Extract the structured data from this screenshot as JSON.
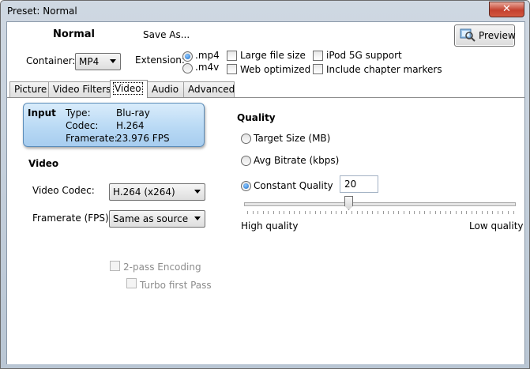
{
  "window": {
    "title": "Preset: Normal",
    "close_glyph": "✕"
  },
  "header": {
    "preset_name": "Normal",
    "save_as_label": "Save As...",
    "preview_label": "Preview",
    "container_label": "Container:",
    "container_value": "MP4",
    "extension_label": "Extension:",
    "extensions": [
      {
        "label": ".mp4",
        "selected": true
      },
      {
        "label": ".m4v",
        "selected": false
      }
    ],
    "options": [
      {
        "label": "Large file size",
        "checked": false
      },
      {
        "label": "Web optimized",
        "checked": false
      },
      {
        "label": "iPod 5G support",
        "checked": false
      },
      {
        "label": "Include chapter markers",
        "checked": false
      }
    ]
  },
  "tabs": [
    {
      "label": "Picture",
      "active": false
    },
    {
      "label": "Video Filters",
      "active": false
    },
    {
      "label": "Video",
      "active": true
    },
    {
      "label": "Audio",
      "active": false
    },
    {
      "label": "Advanced",
      "active": false
    }
  ],
  "input_info": {
    "heading": "Input",
    "type_label": "Type:",
    "type_value": "Blu-ray",
    "codec_label": "Codec:",
    "codec_value": "H.264",
    "framerate_label": "Framerate:",
    "framerate_value": "23.976 FPS"
  },
  "video": {
    "heading": "Video",
    "codec_label": "Video Codec:",
    "codec_value": "H.264 (x264)",
    "fps_label": "Framerate (FPS):",
    "fps_value": "Same as source",
    "two_pass_label": "2-pass Encoding",
    "turbo_label": "Turbo first Pass"
  },
  "quality": {
    "heading": "Quality",
    "target_size_label": "Target Size (MB)",
    "avg_bitrate_label": "Avg Bitrate (kbps)",
    "constant_quality_label": "Constant Quality",
    "selected_mode": "Constant Quality",
    "constant_quality_value": "20",
    "slider_low_label": "High quality",
    "slider_high_label": "Low quality"
  },
  "colors": {
    "accent": "#1e6fc8",
    "input_box": "#b7d8f4",
    "close": "#c4412e"
  }
}
